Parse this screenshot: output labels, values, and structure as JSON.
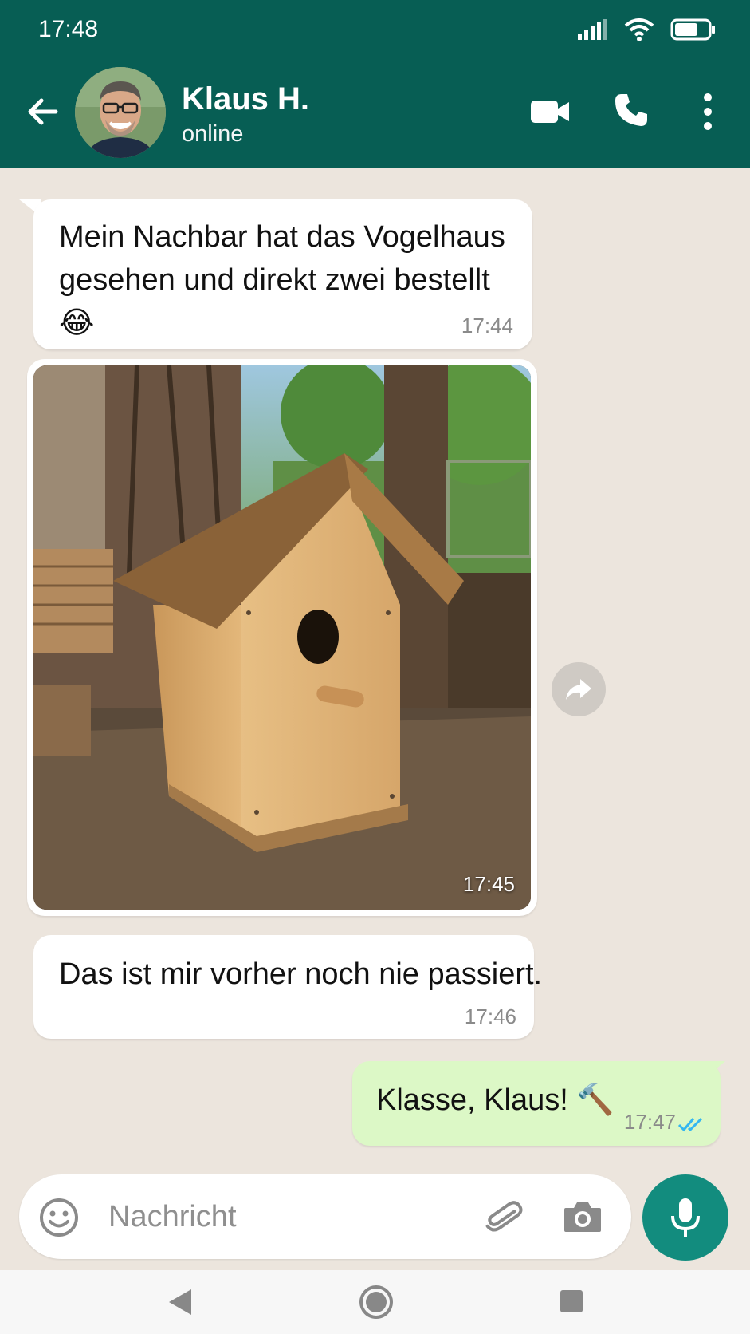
{
  "status_bar": {
    "time": "17:48"
  },
  "header": {
    "contact_name": "Klaus H.",
    "contact_status": "online",
    "icons": [
      "back-arrow-icon",
      "avatar",
      "video-camera-icon",
      "phone-icon",
      "more-vert-icon"
    ]
  },
  "messages": [
    {
      "direction": "incoming",
      "type": "text",
      "text": "Mein Nachbar hat das Vogelhaus gesehen und direkt zwei bestellt 😂",
      "time": "17:44"
    },
    {
      "direction": "incoming",
      "type": "image",
      "subject": "wooden birdhouse on workbench",
      "time": "17:45"
    },
    {
      "direction": "incoming",
      "type": "text",
      "text": "Das ist mir vorher noch nie passiert.",
      "time": "17:46"
    },
    {
      "direction": "outgoing",
      "type": "text",
      "text": "Klasse, Klaus! 🔨",
      "time": "17:47",
      "read_status": "read"
    }
  ],
  "composer": {
    "placeholder": "Nachricht",
    "icons": [
      "emoji-icon",
      "paperclip-icon",
      "camera-icon",
      "mic-icon"
    ]
  },
  "colors": {
    "header": "#075e54",
    "chat_background": "#ece5dd",
    "incoming_bubble": "#ffffff",
    "outgoing_bubble": "#dcf8c6",
    "mic_button": "#128c7e",
    "read_ticks": "#34b7f1"
  }
}
